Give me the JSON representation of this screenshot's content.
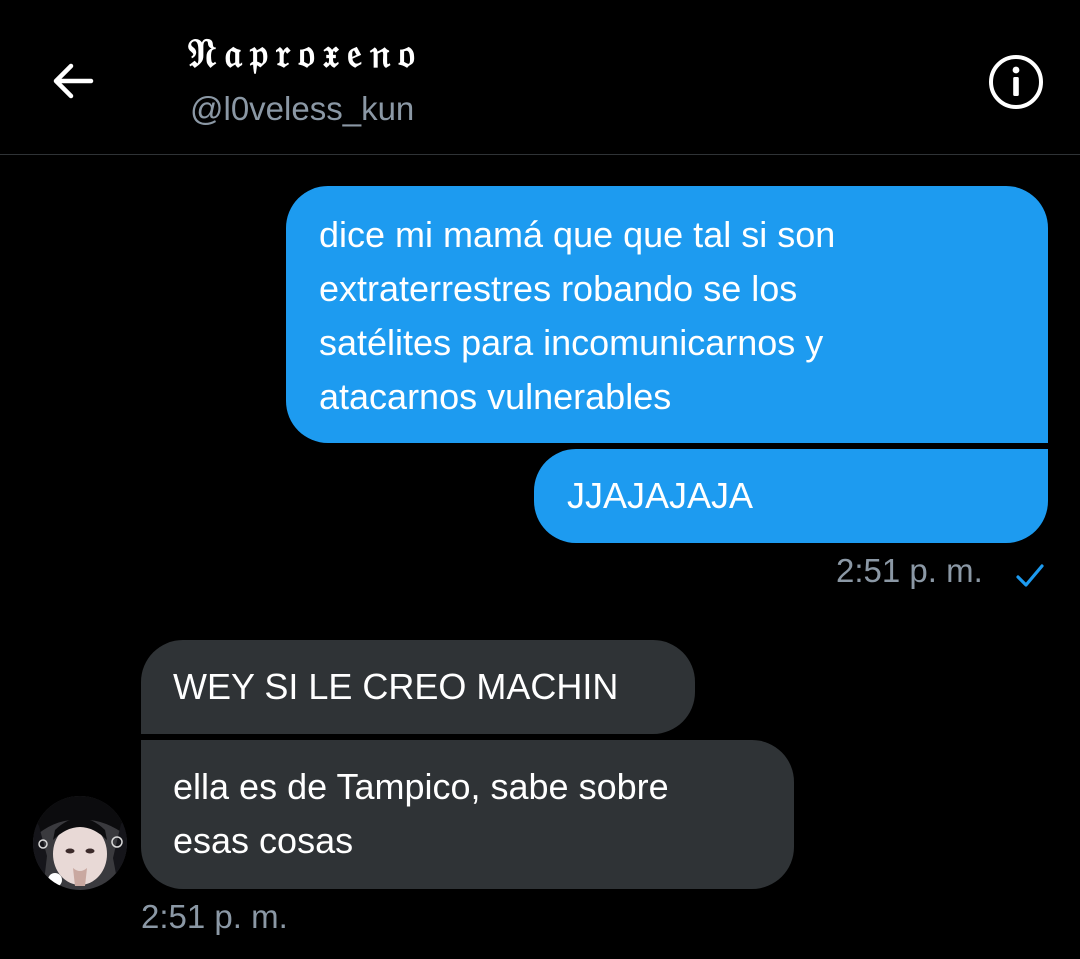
{
  "header": {
    "contact_name": "𝔑𝔞𝔭𝔯𝔬𝔵𝔢𝔫𝔬",
    "contact_handle": "@l0veless_kun",
    "back_icon": "arrow-left-icon",
    "info_icon": "info-icon"
  },
  "messages": [
    {
      "direction": "sent",
      "text": "dice mi mamá que que tal si son\nextraterrestres robando se los\nsatélites para incomunicarnos y\natacarnos vulnerables"
    },
    {
      "direction": "sent",
      "text": "JJAJAJAJA"
    },
    {
      "direction": "received",
      "text": "WEY SI LE CREO MACHIN"
    },
    {
      "direction": "received",
      "text": "ella es de Tampico, sabe sobre\nesas cosas"
    }
  ],
  "sent_group": {
    "timestamp": "2:51 p. m.",
    "status_icon": "checkmark-icon"
  },
  "received_group": {
    "timestamp": "2:51 p. m."
  },
  "colors": {
    "background": "#000000",
    "sent_bubble": "#1d9bf0",
    "received_bubble": "#2f3336",
    "secondary_text": "#8b98a5",
    "divider": "#2f3336"
  }
}
